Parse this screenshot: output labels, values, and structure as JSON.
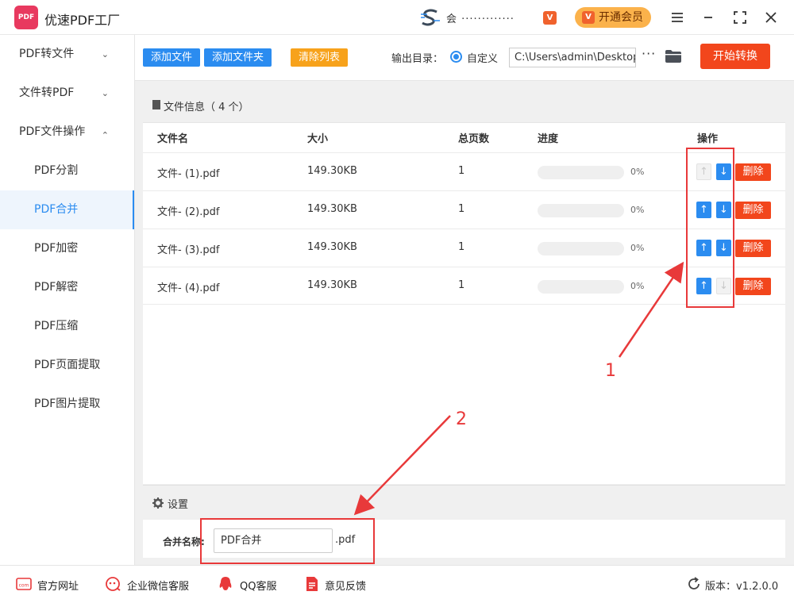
{
  "app": {
    "title": "优速PDF工厂",
    "logo_text": "PDF",
    "user_prefix": "会",
    "user_masked": "·············",
    "vip_mini": "V",
    "vip_button": "开通会员",
    "vip_icon": "V"
  },
  "sidebar": {
    "groups": [
      {
        "label": "PDF转文件",
        "chevron": "⌄"
      },
      {
        "label": "文件转PDF",
        "chevron": "⌄"
      },
      {
        "label": "PDF文件操作",
        "chevron": "⌃"
      }
    ],
    "items": [
      {
        "label": "PDF分割"
      },
      {
        "label": "PDF合并"
      },
      {
        "label": "PDF加密"
      },
      {
        "label": "PDF解密"
      },
      {
        "label": "PDF压缩"
      },
      {
        "label": "PDF页面提取"
      },
      {
        "label": "PDF图片提取"
      }
    ],
    "active_item": "PDF合并"
  },
  "toolbar": {
    "add_file": "添加文件",
    "add_folder": "添加文件夹",
    "clear_list": "清除列表",
    "output_label": "输出目录：",
    "custom_label": "自定义",
    "output_path": "C:\\Users\\admin\\Desktop",
    "more": "···",
    "start": "开始转换"
  },
  "files": {
    "header": "文件信息（ 4 个）",
    "columns": {
      "name": "文件名",
      "size": "大小",
      "pages": "总页数",
      "progress": "进度",
      "actions": "操作"
    },
    "rows": [
      {
        "name": "文件- (1).pdf",
        "size": "149.30KB",
        "pages": "1",
        "progress": 0,
        "progress_text": "0%",
        "delete": "删除"
      },
      {
        "name": "文件- (2).pdf",
        "size": "149.30KB",
        "pages": "1",
        "progress": 0,
        "progress_text": "0%",
        "delete": "删除"
      },
      {
        "name": "文件- (3).pdf",
        "size": "149.30KB",
        "pages": "1",
        "progress": 0,
        "progress_text": "0%",
        "delete": "删除"
      },
      {
        "name": "文件- (4).pdf",
        "size": "149.30KB",
        "pages": "1",
        "progress": 0,
        "progress_text": "0%",
        "delete": "删除"
      }
    ],
    "up_glyph": "↑",
    "down_glyph": "↓"
  },
  "settings": {
    "header": "设置",
    "merge_label": "合并名称:",
    "merge_value": "PDF合并",
    "merge_ext": ".pdf"
  },
  "annotations": {
    "one": "1",
    "two": "2"
  },
  "footer": {
    "website": "官方网址",
    "wechat": "企业微信客服",
    "qq": "QQ客服",
    "feedback": "意见反馈",
    "version": "版本：v1.2.0.0",
    "website_icon_text": "com"
  },
  "colors": {
    "accent": "#2b8cf0",
    "danger": "#f2461c",
    "warning": "#f7a21b",
    "annotation": "#e8393a"
  }
}
